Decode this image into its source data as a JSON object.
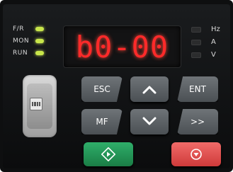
{
  "indicators": [
    {
      "label": "F/R",
      "color": "#c8e64a"
    },
    {
      "label": "MON",
      "color": "#c8e64a"
    },
    {
      "label": "RUN",
      "color": "#c8e64a"
    }
  ],
  "display": {
    "text": "b0-00",
    "color": "#ff2a2a"
  },
  "units": [
    {
      "label": "Hz"
    },
    {
      "label": "A"
    },
    {
      "label": "V"
    }
  ],
  "keys": {
    "esc": "ESC",
    "ent": "ENT",
    "mf": "MF",
    "shift": ">>",
    "up_icon": "chevron-up-icon",
    "down_icon": "chevron-down-icon",
    "run_icon": "run-icon",
    "stop_icon": "stop-icon"
  }
}
